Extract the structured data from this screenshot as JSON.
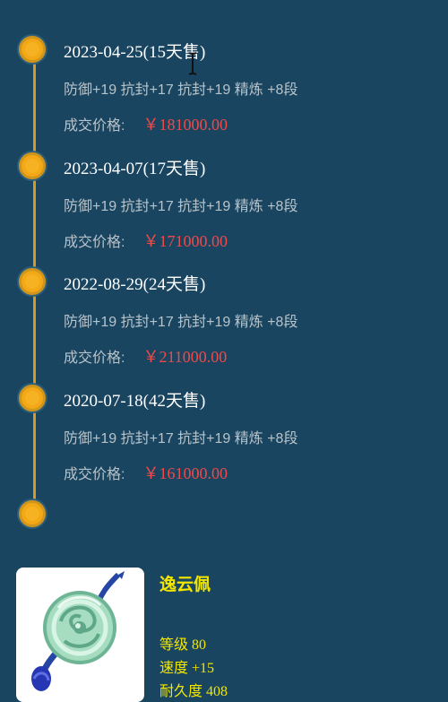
{
  "history": [
    {
      "date": "2023-04-25(15天售)",
      "attributes": "防御+19 抗封+17 抗封+19 精炼 +8段",
      "price_label": "成交价格:",
      "price": "￥181000.00"
    },
    {
      "date": "2023-04-07(17天售)",
      "attributes": "防御+19 抗封+17 抗封+19 精炼 +8段",
      "price_label": "成交价格:",
      "price": "￥171000.00"
    },
    {
      "date": "2022-08-29(24天售)",
      "attributes": "防御+19 抗封+17 抗封+19 精炼 +8段",
      "price_label": "成交价格:",
      "price": "￥211000.00"
    },
    {
      "date": "2020-07-18(42天售)",
      "attributes": "防御+19 抗封+17 抗封+19 精炼 +8段",
      "price_label": "成交价格:",
      "price": "￥161000.00"
    }
  ],
  "item": {
    "name": "逸云佩",
    "icon": "jade-pendant-icon",
    "stats": [
      "等级 80",
      "速度 +15",
      "耐久度 408"
    ]
  },
  "colors": {
    "background": "#1a4560",
    "timeline": "#d79a1f",
    "dot": "#f3a816",
    "price": "#ef4a4a",
    "item_text": "#f2e600"
  }
}
